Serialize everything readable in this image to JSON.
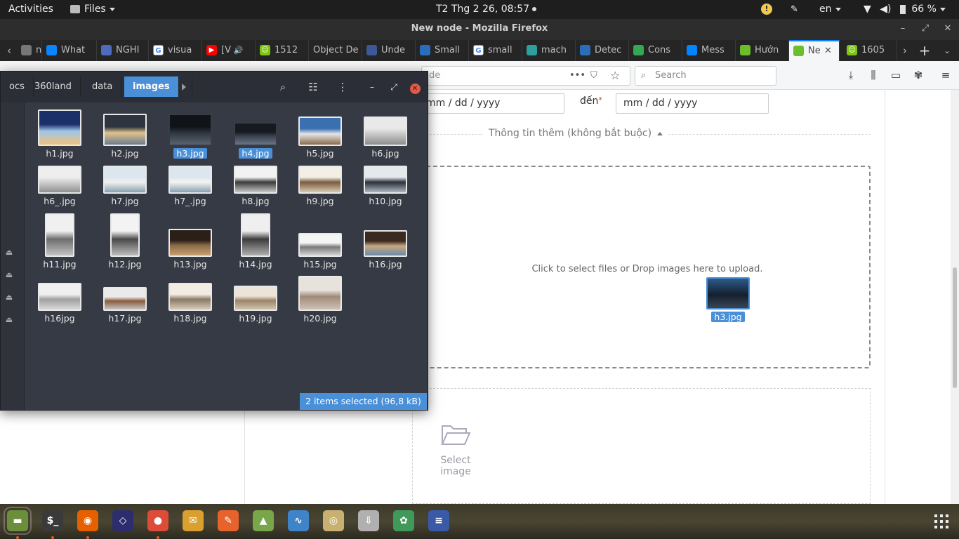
{
  "topbar": {
    "activities": "Activities",
    "app_menu": "Files",
    "clock": "T2 Thg 2 26, 08:57",
    "language": "en",
    "battery": "66 %"
  },
  "firefox": {
    "window_title": "New node - Mozilla Firefox",
    "tabs": [
      {
        "label": "nve",
        "favicon": "doc-icon",
        "color": "#777777"
      },
      {
        "label": "What",
        "favicon": "meta-icon",
        "color": "#0a84ff"
      },
      {
        "label": "NGHI",
        "favicon": "doc-icon",
        "color": "#4f6bbd"
      },
      {
        "label": "visua",
        "favicon": "google-icon",
        "color": "#ffffff"
      },
      {
        "label": "[V",
        "favicon": "youtube-icon",
        "color": "#ff0000"
      },
      {
        "label": "1512",
        "favicon": "smiley-icon",
        "color": "#7ac70c"
      },
      {
        "label": "Object De",
        "favicon": "",
        "color": ""
      },
      {
        "label": "Unde",
        "favicon": "page-icon",
        "color": "#3b5998"
      },
      {
        "label": "Small",
        "favicon": "chat-icon",
        "color": "#2a6ebb"
      },
      {
        "label": "small",
        "favicon": "google-icon",
        "color": "#ffffff"
      },
      {
        "label": "mach",
        "favicon": "grid-icon",
        "color": "#2f9e9e"
      },
      {
        "label": "Detec",
        "favicon": "chat-icon",
        "color": "#2a6ebb"
      },
      {
        "label": "Cons",
        "favicon": "pin-icon",
        "color": "#34a853"
      },
      {
        "label": "Mess",
        "favicon": "messenger-icon",
        "color": "#0084ff"
      },
      {
        "label": "Hướn",
        "favicon": "diamond-icon",
        "color": "#6abf2b"
      },
      {
        "label": "Ne",
        "favicon": "diamond-icon",
        "color": "#6abf2b"
      },
      {
        "label": "1605",
        "favicon": "smiley-icon",
        "color": "#7ac70c"
      }
    ],
    "url_fragment": "de",
    "search_placeholder": "Search"
  },
  "page": {
    "date_from_fragment": "mm / dd / yyyy",
    "date_to_label": "đến",
    "required_mark": "*",
    "date_to_placeholder": "mm / dd / yyyy",
    "optional_section": "Thông tin thêm (không bắt buộc)",
    "dropzone_text": "Click to select files or Drop images here to upload.",
    "select_image": "Select image"
  },
  "nautilus": {
    "breadcrumbs": [
      "ocs",
      "360land",
      "data",
      "images"
    ],
    "files": [
      {
        "name": "h1.jpg",
        "selected": false,
        "palette": [
          "#1b2f6b",
          "#9fc5e8",
          "#f1c27d"
        ]
      },
      {
        "name": "h2.jpg",
        "selected": false,
        "palette": [
          "#2e3440",
          "#e0c48c",
          "#6b7a8f"
        ]
      },
      {
        "name": "h3.jpg",
        "selected": true,
        "palette": [
          "#101418",
          "#2f3640",
          "#5a6270"
        ]
      },
      {
        "name": "h4.jpg",
        "selected": true,
        "palette": [
          "#161a20",
          "#3a4250",
          "#6a7585"
        ]
      },
      {
        "name": "h5.jpg",
        "selected": false,
        "palette": [
          "#3a6fb0",
          "#e6e6e6",
          "#8a6a4a"
        ]
      },
      {
        "name": "h6.jpg",
        "selected": false,
        "palette": [
          "#e9e9e9",
          "#c8c8c8",
          "#8d8d8d"
        ]
      },
      {
        "name": "h6_.jpg",
        "selected": false,
        "palette": [
          "#eeeeee",
          "#cfcfcf",
          "#909090"
        ]
      },
      {
        "name": "h7.jpg",
        "selected": false,
        "palette": [
          "#dce6ee",
          "#f0f0f0",
          "#8aa0b0"
        ]
      },
      {
        "name": "h7_.jpg",
        "selected": false,
        "palette": [
          "#dce6ee",
          "#f3f3f3",
          "#8aa0b0"
        ]
      },
      {
        "name": "h8.jpg",
        "selected": false,
        "palette": [
          "#f2f2f2",
          "#3a3a3a",
          "#c9c9c9"
        ]
      },
      {
        "name": "h9.jpg",
        "selected": false,
        "palette": [
          "#f4efe6",
          "#7a5c3e",
          "#d8cbb5"
        ]
      },
      {
        "name": "h10.jpg",
        "selected": false,
        "palette": [
          "#e4e9ee",
          "#2c3038",
          "#aeb8c2"
        ]
      },
      {
        "name": "h11.jpg",
        "selected": false,
        "palette": [
          "#f0f0f0",
          "#6d6d6d",
          "#c4c4c4"
        ]
      },
      {
        "name": "h12.jpg",
        "selected": false,
        "palette": [
          "#f3f3f3",
          "#4a4a4a",
          "#bdbdbd"
        ]
      },
      {
        "name": "h13.jpg",
        "selected": false,
        "palette": [
          "#2a2018",
          "#8a6a48",
          "#c8a070"
        ]
      },
      {
        "name": "h14.jpg",
        "selected": false,
        "palette": [
          "#efefef",
          "#3c3c3c",
          "#b0b0b0"
        ]
      },
      {
        "name": "h15.jpg",
        "selected": false,
        "palette": [
          "#f5f5f5",
          "#7a7a7a",
          "#d6d6d6"
        ]
      },
      {
        "name": "h16.jpg",
        "selected": false,
        "palette": [
          "#3a2a20",
          "#c8a880",
          "#6a8aa8"
        ]
      },
      {
        "name": "h16jpg",
        "selected": false,
        "palette": [
          "#f0f0f0",
          "#a0a0a0",
          "#d9d9d9"
        ]
      },
      {
        "name": "h17.jpg",
        "selected": false,
        "palette": [
          "#eaeaea",
          "#8a5a3a",
          "#c7c7c7"
        ]
      },
      {
        "name": "h18.jpg",
        "selected": false,
        "palette": [
          "#f2ece2",
          "#8a7a66",
          "#d8ccba"
        ]
      },
      {
        "name": "h19.jpg",
        "selected": false,
        "palette": [
          "#ece4d8",
          "#9a8468",
          "#d2c4ae"
        ]
      },
      {
        "name": "h20.jpg",
        "selected": false,
        "palette": [
          "#e8e2dc",
          "#a08a7a",
          "#cfc2b6"
        ]
      }
    ],
    "status": "2 items selected  (96,8 kB)"
  },
  "drag": {
    "name": "h3.jpg"
  },
  "dock": {
    "apps": [
      {
        "name": "files-app-icon",
        "color": "#6b8e3a",
        "glyph": "▬",
        "running": true
      },
      {
        "name": "terminal-app-icon",
        "color": "#3a3a3a",
        "glyph": "$_",
        "running": true
      },
      {
        "name": "firefox-app-icon",
        "color": "#e66000",
        "glyph": "◉",
        "running": true
      },
      {
        "name": "visual-studio-code-icon",
        "color": "#2b2d6e",
        "glyph": "◇",
        "running": false
      },
      {
        "name": "chrome-app-icon",
        "color": "#dd4b39",
        "glyph": "●",
        "running": true
      },
      {
        "name": "postman-app-icon",
        "color": "#d9a030",
        "glyph": "✉",
        "running": false
      },
      {
        "name": "text-editor-icon",
        "color": "#e8622b",
        "glyph": "✎",
        "running": false
      },
      {
        "name": "android-studio-icon",
        "color": "#78a64a",
        "glyph": "▲",
        "running": false
      },
      {
        "name": "system-monitor-icon",
        "color": "#3f84c8",
        "glyph": "∿",
        "running": false
      },
      {
        "name": "speaker-app-icon",
        "color": "#c8b070",
        "glyph": "◎",
        "running": false
      },
      {
        "name": "store-app-icon",
        "color": "#b0b0b0",
        "glyph": "⇩",
        "running": false
      },
      {
        "name": "gitkraken-app-icon",
        "color": "#3f9a5a",
        "glyph": "✿",
        "running": false
      },
      {
        "name": "document-viewer-icon",
        "color": "#3a5aa8",
        "glyph": "≡",
        "running": false
      }
    ]
  }
}
